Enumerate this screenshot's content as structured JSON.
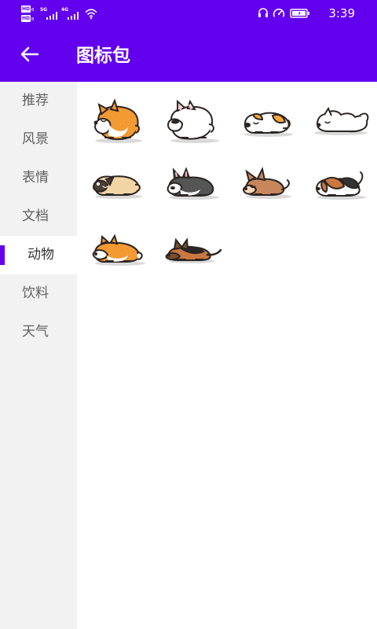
{
  "status_bar": {
    "hd_badge": "HD",
    "hd_sub": "B",
    "network_5g": "5G",
    "network_4g": "4G",
    "time": "3:39"
  },
  "toolbar": {
    "title": "图标包"
  },
  "sidebar": {
    "selected_index": 4,
    "items": [
      {
        "label": "推荐"
      },
      {
        "label": "风景"
      },
      {
        "label": "表情"
      },
      {
        "label": "文档"
      },
      {
        "label": "动物"
      },
      {
        "label": "饮料"
      },
      {
        "label": "天气"
      }
    ]
  },
  "grid": {
    "items": [
      {
        "icon": "corgi-sticker",
        "colors": [
          "#F39A32",
          "#FFFFFF"
        ]
      },
      {
        "icon": "white-bulldog-sticker",
        "colors": [
          "#FFFFFF",
          "#F7B6C1"
        ]
      },
      {
        "icon": "jack-russell-sticker",
        "colors": [
          "#FFFFFF",
          "#F4A93A"
        ]
      },
      {
        "icon": "white-fluffy-dog-sticker",
        "colors": [
          "#FFFFFF",
          "#111111"
        ]
      },
      {
        "icon": "pug-sticker",
        "colors": [
          "#F1D5A4",
          "#4A4036"
        ]
      },
      {
        "icon": "boston-terrier-sticker",
        "colors": [
          "#555555",
          "#FFFFFF"
        ]
      },
      {
        "icon": "chihuahua-sticker",
        "colors": [
          "#C8875A",
          "#F8D8B8"
        ]
      },
      {
        "icon": "beagle-sticker",
        "colors": [
          "#C9783F",
          "#333333"
        ]
      },
      {
        "icon": "shiba-sticker",
        "colors": [
          "#F39A32",
          "#FFFFFF"
        ]
      },
      {
        "icon": "german-shepherd-sticker",
        "colors": [
          "#7A4F2A",
          "#2B2626"
        ]
      }
    ]
  },
  "theme": {
    "primary": "#6200EE",
    "sidebar_bg": "#F2F2F2",
    "content_bg": "#FFFFFF"
  }
}
